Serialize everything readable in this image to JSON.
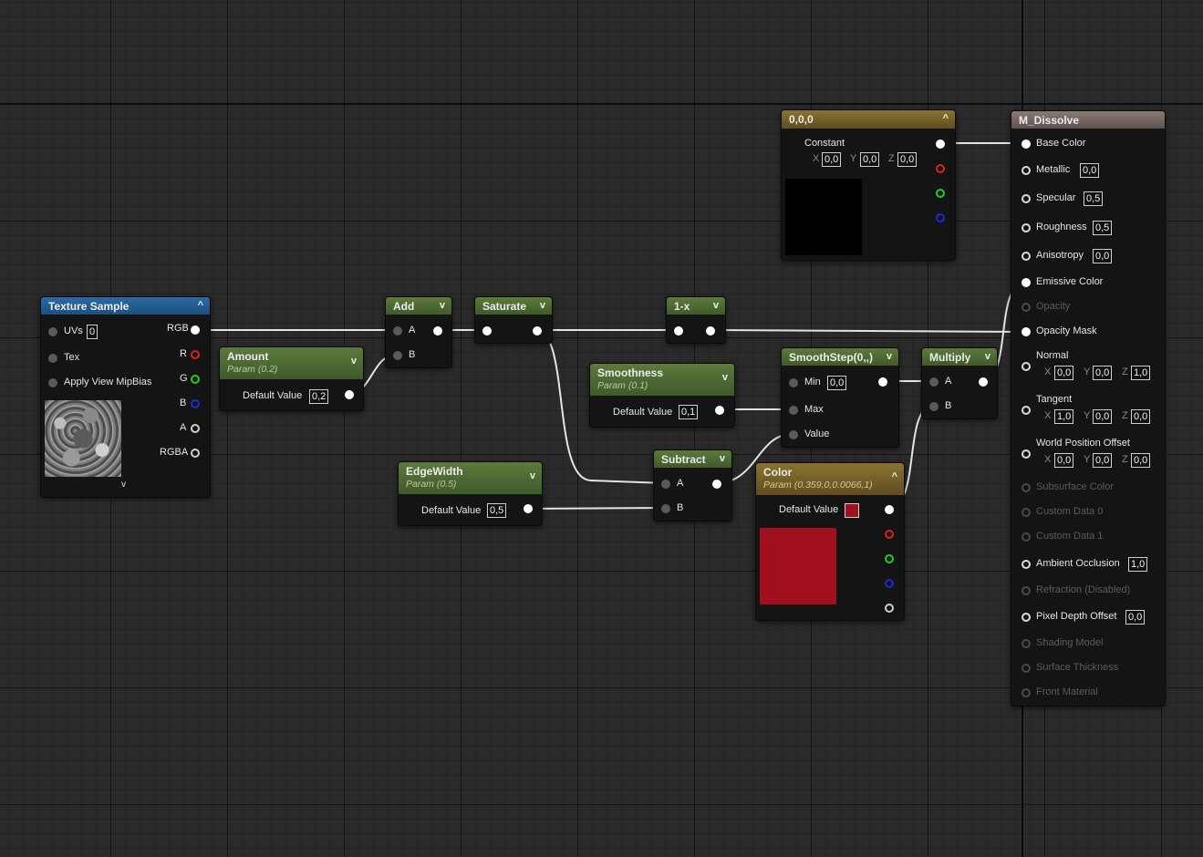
{
  "colors": {
    "color_param_swatch": "#a0101e",
    "constant_swatch": "#000000",
    "node_green": "#5d7a3b",
    "node_blue": "#2c6aa3",
    "node_gold": "#8a7331"
  },
  "texture_sample": {
    "title": "Texture Sample",
    "uvs_label": "UVs",
    "uvs_value": "0",
    "tex_label": "Tex",
    "mip_label": "Apply View MipBias",
    "outputs": [
      "RGB",
      "R",
      "G",
      "B",
      "A",
      "RGBA"
    ]
  },
  "amount": {
    "title": "Amount",
    "subtitle": "Param (0.2)",
    "default_label": "Default Value",
    "default_value": "0,2"
  },
  "add": {
    "title": "Add",
    "in_a": "A",
    "in_b": "B"
  },
  "saturate": {
    "title": "Saturate"
  },
  "one_minus_x": {
    "title": "1-x"
  },
  "smoothness": {
    "title": "Smoothness",
    "subtitle": "Param (0.1)",
    "default_label": "Default Value",
    "default_value": "0,1"
  },
  "smoothstep": {
    "title": "SmoothStep(0,,)",
    "min_label": "Min",
    "min_value": "0,0",
    "max_label": "Max",
    "value_label": "Value"
  },
  "multiply": {
    "title": "Multiply",
    "in_a": "A",
    "in_b": "B"
  },
  "edgewidth": {
    "title": "EdgeWidth",
    "subtitle": "Param (0.5)",
    "default_label": "Default Value",
    "default_value": "0,5"
  },
  "subtract": {
    "title": "Subtract",
    "in_a": "A",
    "in_b": "B"
  },
  "color_param": {
    "title": "Color",
    "subtitle": "Param (0.359,0,0.0066,1)",
    "default_label": "Default Value"
  },
  "constant": {
    "title": "0,0,0",
    "label": "Constant",
    "x_label": "X",
    "x": "0,0",
    "y_label": "Y",
    "y": "0,0",
    "z_label": "Z",
    "z": "0,0"
  },
  "material": {
    "title": "M_Dissolve",
    "base_color": "Base Color",
    "metallic": "Metallic",
    "metallic_value": "0,0",
    "specular": "Specular",
    "specular_value": "0,5",
    "roughness": "Roughness",
    "roughness_value": "0,5",
    "anisotropy": "Anisotropy",
    "anisotropy_value": "0,0",
    "emissive": "Emissive Color",
    "opacity": "Opacity",
    "opacity_mask": "Opacity Mask",
    "normal": "Normal",
    "normal_x": "0,0",
    "normal_y": "0,0",
    "normal_z": "1,0",
    "tangent": "Tangent",
    "tangent_x": "1,0",
    "tangent_y": "0,0",
    "tangent_z": "0,0",
    "wpo": "World Position Offset",
    "wpo_x": "0,0",
    "wpo_y": "0,0",
    "wpo_z": "0,0",
    "x_label": "X",
    "y_label": "Y",
    "z_label": "Z",
    "subsurface": "Subsurface Color",
    "custom0": "Custom Data 0",
    "custom1": "Custom Data 1",
    "ao": "Ambient Occlusion",
    "ao_value": "1,0",
    "refraction": "Refraction (Disabled)",
    "pdo": "Pixel Depth Offset",
    "pdo_value": "0,0",
    "shading_model": "Shading Model",
    "surface_thickness": "Surface Thickness",
    "front_material": "Front Material"
  }
}
